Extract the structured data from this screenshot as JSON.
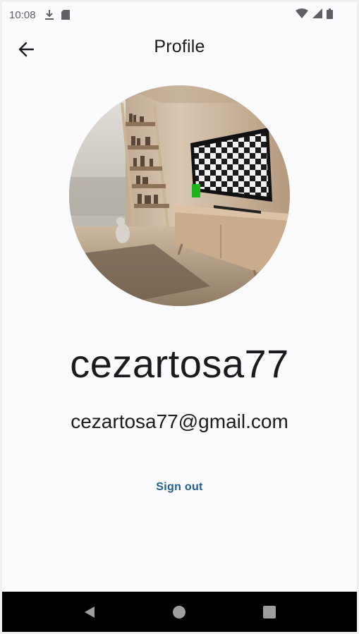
{
  "status_bar": {
    "time": "10:08",
    "icons": [
      "download-icon",
      "sd-card-icon",
      "wifi-icon",
      "signal-icon",
      "battery-icon"
    ]
  },
  "app_bar": {
    "title": "Profile",
    "back_icon": "arrow-back-icon"
  },
  "profile": {
    "avatar": "room-with-tv-photo",
    "username": "cezartosa77",
    "email": "cezartosa77@gmail.com",
    "sign_out_label": "Sign out"
  },
  "nav_bar": {
    "icons": [
      "back-triangle-icon",
      "home-circle-icon",
      "recents-square-icon"
    ]
  },
  "colors": {
    "background": "#fbfbfe",
    "text": "#1b1b1f",
    "accent": "#1f5f8f",
    "nav_bar": "#000000"
  }
}
